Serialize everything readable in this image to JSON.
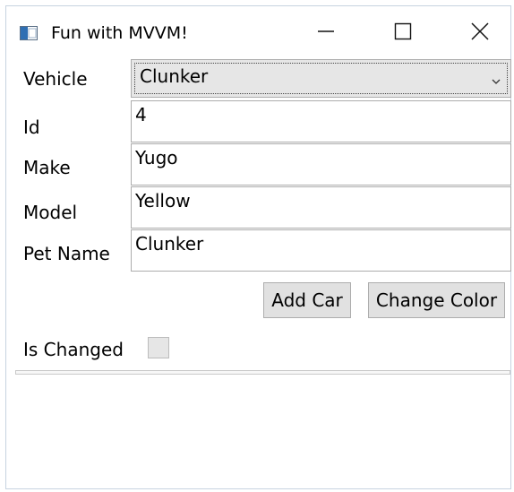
{
  "window": {
    "title": "Fun with MVVM!"
  },
  "icons": {
    "app": "app-window-icon",
    "minimize": "minimize-icon",
    "maximize": "maximize-icon",
    "close": "close-icon",
    "dropdown": "chevron-down-icon"
  },
  "form": {
    "vehicle": {
      "label": "Vehicle",
      "selected": "Clunker"
    },
    "id": {
      "label": "Id",
      "value": "4"
    },
    "make": {
      "label": "Make",
      "value": "Yugo"
    },
    "model": {
      "label": "Model",
      "value": "Yellow"
    },
    "pet_name": {
      "label": "Pet Name",
      "value": "Clunker"
    },
    "is_changed": {
      "label": "Is Changed",
      "checked": false
    }
  },
  "buttons": {
    "add_car": "Add Car",
    "change_color": "Change Color"
  }
}
